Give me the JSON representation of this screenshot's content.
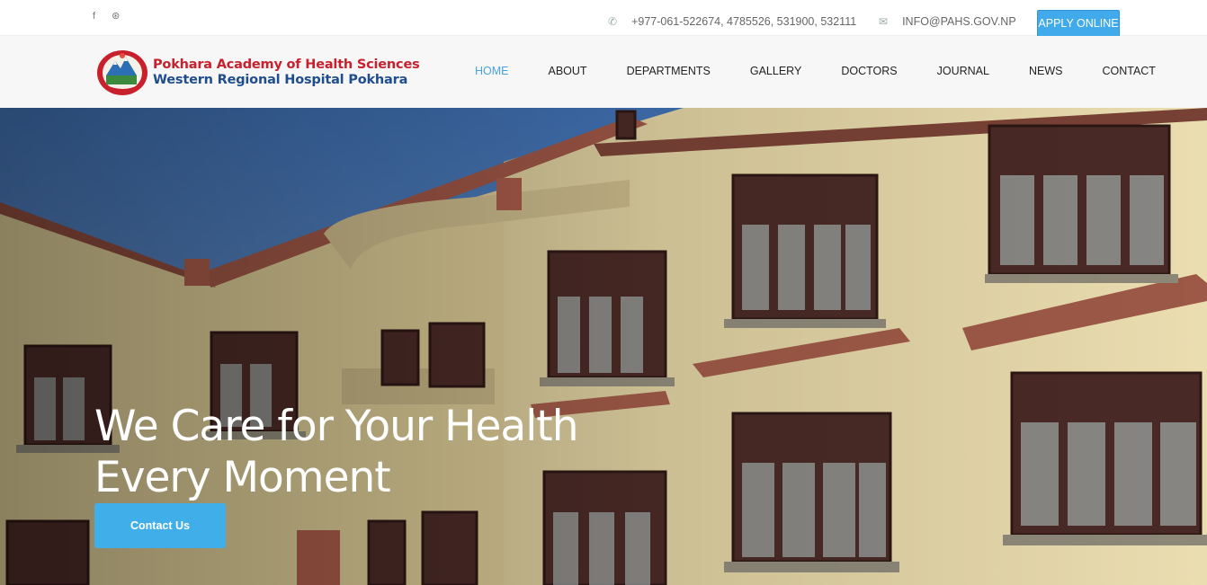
{
  "topbar": {
    "social": [
      {
        "name": "facebook-icon",
        "glyph": "f"
      },
      {
        "name": "dribbble-icon",
        "glyph": "⊛"
      }
    ],
    "phone": "+977-061-522674, 4785526, 531900, 532111",
    "email": "INFO@PAHS.GOV.NP",
    "apply_label": "APPLY ONLINE",
    "phone_icon": "phone-icon",
    "email_icon": "envelope-icon"
  },
  "header": {
    "logo_line1": "Pokhara Academy of Health Sciences",
    "logo_line2": "Western Regional Hospital Pokhara",
    "nav": [
      {
        "label": "HOME",
        "active": true
      },
      {
        "label": "ABOUT",
        "active": false
      },
      {
        "label": "DEPARTMENTS",
        "active": false
      },
      {
        "label": "GALLERY",
        "active": false
      },
      {
        "label": "DOCTORS",
        "active": false
      },
      {
        "label": "JOURNAL",
        "active": false
      },
      {
        "label": "NEWS",
        "active": false
      },
      {
        "label": "CONTACT",
        "active": false
      }
    ]
  },
  "hero": {
    "title_line1": "We Care for Your Health",
    "title_line2": "Every Moment",
    "button_label": "Contact Us"
  },
  "colors": {
    "accent": "#40aaeb",
    "nav_active": "#4aa3d8",
    "logo_red": "#c8202c",
    "logo_blue": "#1f4d8e"
  }
}
